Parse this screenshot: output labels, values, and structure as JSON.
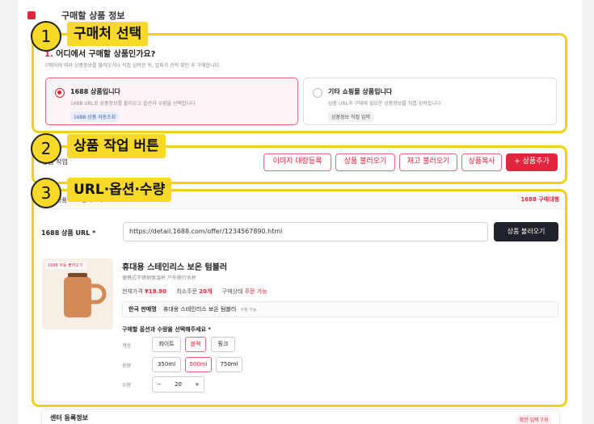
{
  "section_title": "구매할 상품 정보",
  "annotations": [
    {
      "number": "1",
      "label": "구매처 선택"
    },
    {
      "number": "2",
      "label": "상품 작업 버튼"
    },
    {
      "number": "3",
      "label": "URL·옵션·수량"
    }
  ],
  "purchase_source": {
    "question_number": "1.",
    "question": "어디에서 구매할 상품인가요?",
    "description": "구매처에 따라 상품정보를 불러오거나 직접 입력한 뒤, 알파가 견적 확인 후 구매합니다.",
    "options": [
      {
        "title": "1688 상품입니다",
        "desc": "1688 URL로 상품정보를 불러오고 옵션과 수량을 선택합니다.",
        "chip": "1688 상품 자동조회",
        "selected": true
      },
      {
        "title": "기타 쇼핑몰 상품입니다",
        "desc": "상품 URL과 구매에 필요한 상품정보를 직접 입력합니다.",
        "chip": "상품정보 직접 입력",
        "selected": false
      }
    ]
  },
  "actions": {
    "label": "상품 작업",
    "buttons": [
      "이미지 대량등록",
      "상품 불러오기",
      "재고 불러오기",
      "상품복사",
      "+ 상품추가"
    ]
  },
  "product_panel": {
    "header": "1688 상품 URL 불러오기",
    "badge": "1688 구매대행",
    "url_label": "1688 상품 URL *",
    "url_value": "https://detail.1688.com/offer/1234567890.html",
    "load_button": "상품 불러오기",
    "image_chip": "1688 자동 불러오기",
    "name_ko": "휴대용 스테인리스 보온 텀블러",
    "name_cn": "便携式不锈钢保温杯 户外随行水杯",
    "price_label": "현재가격",
    "price": "¥18.80",
    "moq_label": "최소주문",
    "moq": "20개",
    "status_label": "구매상태",
    "status": "주문 가능",
    "korean_name_label": "한국 판매명",
    "korean_name": "휴대용 스테인리스 보온 텀블러",
    "korean_name_note": "수정 가능",
    "option_prompt": "구매할 옵션과 수량을 선택해주세요 *",
    "color_label": "색상",
    "colors": [
      "화이트",
      "블랙",
      "핑크"
    ],
    "selected_color": 1,
    "size_label": "용량",
    "sizes": [
      "350ml",
      "500ml",
      "750ml"
    ],
    "selected_size": 1,
    "qty_label": "수량",
    "qty_minus": "−",
    "qty_value": "20",
    "qty_plus": "+"
  },
  "center_section": {
    "title": "센터 등록정보",
    "badge": "확인·입력 7개"
  },
  "colors": {
    "accent": "#e2243c",
    "highlight": "#f2cf1f",
    "dark_button": "#1f2329",
    "mug": "#d48a57"
  }
}
